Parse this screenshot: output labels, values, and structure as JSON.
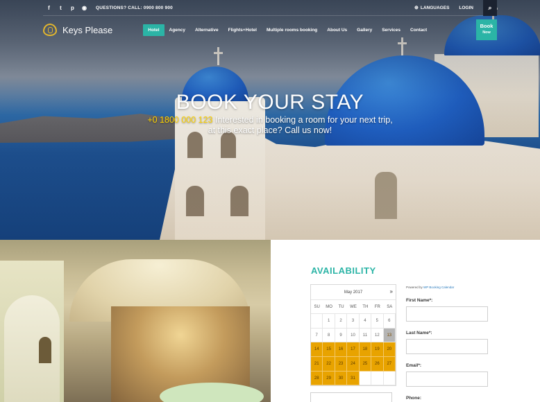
{
  "topbar": {
    "social": [
      {
        "icon": "facebook-icon",
        "glyph": "f"
      },
      {
        "icon": "twitter-icon",
        "glyph": "t"
      },
      {
        "icon": "pinterest-icon",
        "glyph": "p"
      },
      {
        "icon": "tripadvisor-icon",
        "glyph": "◉"
      }
    ],
    "questions_label": "QUESTIONS? CALL:",
    "questions_phone": "0900 800 900",
    "languages_label": "LANGUAGES",
    "login_label": "LOGIN",
    "search_glyph": "⌕"
  },
  "nav": {
    "logo_text": "Keys Please",
    "items": [
      {
        "label": "Hotel",
        "active": true
      },
      {
        "label": "Agency"
      },
      {
        "label": "Alternative"
      },
      {
        "label": "Flights+Hotel"
      },
      {
        "label": "Multiple rooms booking"
      },
      {
        "label": "About Us"
      },
      {
        "label": "Gallery"
      },
      {
        "label": "Services"
      },
      {
        "label": "Contact"
      }
    ],
    "book_line1": "Book",
    "book_line2": "Now"
  },
  "hero": {
    "title": "BOOK YOUR STAY",
    "phone": "+0 1800 000 123",
    "line1_rest": " Interested in booking a room for your next trip,",
    "line2": "at this exact place? Call us now!"
  },
  "availability": {
    "title": "AVAILABILITY",
    "month": "May 2017",
    "next_glyph": "»",
    "dow": [
      "SU",
      "MO",
      "TU",
      "WE",
      "TH",
      "FR",
      "SA"
    ],
    "days": [
      [
        "",
        "1",
        "2",
        "3",
        "4",
        "5",
        "6"
      ],
      [
        "7",
        "8",
        "9",
        "10",
        "11",
        "12",
        "13"
      ],
      [
        "14",
        "15",
        "16",
        "17",
        "18",
        "19",
        "20"
      ],
      [
        "21",
        "22",
        "23",
        "24",
        "25",
        "26",
        "27"
      ],
      [
        "28",
        "29",
        "30",
        "31",
        "",
        "",
        ""
      ]
    ],
    "today": "13",
    "available_from": 14,
    "available_to": 31,
    "powered_prefix": "Powered by ",
    "powered_link": "WP Booking Calendar",
    "fields": [
      "First Name*:",
      "Last Name*:",
      "Email*:",
      "Phone:"
    ],
    "colors": {
      "accent": "#2bb4a6",
      "available": "#e8a300",
      "today": "#b5b5b5"
    }
  }
}
